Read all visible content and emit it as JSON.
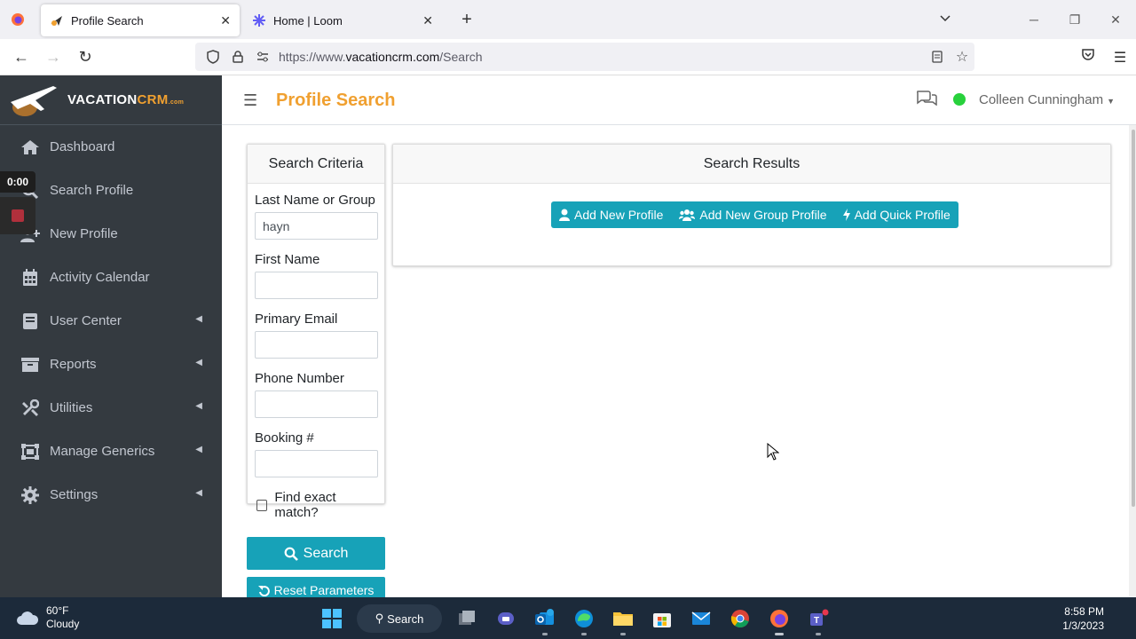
{
  "browser": {
    "tabs": [
      {
        "title": "Profile Search",
        "active": true
      },
      {
        "title": "Home | Loom",
        "active": false
      }
    ],
    "url_prefix": "https://www.",
    "url_domain": "vacationcrm.com",
    "url_path": "/Search"
  },
  "brand": {
    "part1": "VACATION",
    "part2": "CRM",
    "suffix": ".com"
  },
  "loom": {
    "timer": "0:00"
  },
  "sidebar": {
    "items": [
      {
        "label": "Dashboard",
        "icon": "home-icon",
        "expandable": false
      },
      {
        "label": "Search Profile",
        "icon": "search-icon",
        "expandable": false
      },
      {
        "label": "New Profile",
        "icon": "user-plus-icon",
        "expandable": false
      },
      {
        "label": "Activity Calendar",
        "icon": "calendar-icon",
        "expandable": false
      },
      {
        "label": "User Center",
        "icon": "book-icon",
        "expandable": true
      },
      {
        "label": "Reports",
        "icon": "archive-icon",
        "expandable": true
      },
      {
        "label": "Utilities",
        "icon": "tools-icon",
        "expandable": true
      },
      {
        "label": "Manage Generics",
        "icon": "object-group-icon",
        "expandable": true
      },
      {
        "label": "Settings",
        "icon": "gear-icon",
        "expandable": true
      }
    ]
  },
  "header": {
    "title": "Profile Search",
    "user_name": "Colleen Cunningham"
  },
  "criteria": {
    "title": "Search Criteria",
    "last_name_label": "Last Name or Group",
    "last_name_value": "hayn",
    "first_name_label": "First Name",
    "first_name_value": "",
    "email_label": "Primary Email",
    "email_value": "",
    "phone_label": "Phone Number",
    "phone_value": "",
    "booking_label": "Booking #",
    "booking_value": "",
    "exact_match_label": "Find exact match?"
  },
  "results": {
    "title": "Search Results",
    "add_profile": "Add New Profile",
    "add_group_profile": "Add New Group Profile",
    "add_quick_profile": "Add Quick Profile"
  },
  "actions": {
    "search": "Search",
    "reset": "Reset Parameters"
  },
  "taskbar": {
    "temp": "60°F",
    "condition": "Cloudy",
    "search_label": "Search",
    "time": "8:58 PM",
    "date": "1/3/2023"
  },
  "colors": {
    "accent": "#17a2b8",
    "title_orange": "#f0a030",
    "sidebar_bg": "#343a40",
    "online": "#28d13c"
  }
}
